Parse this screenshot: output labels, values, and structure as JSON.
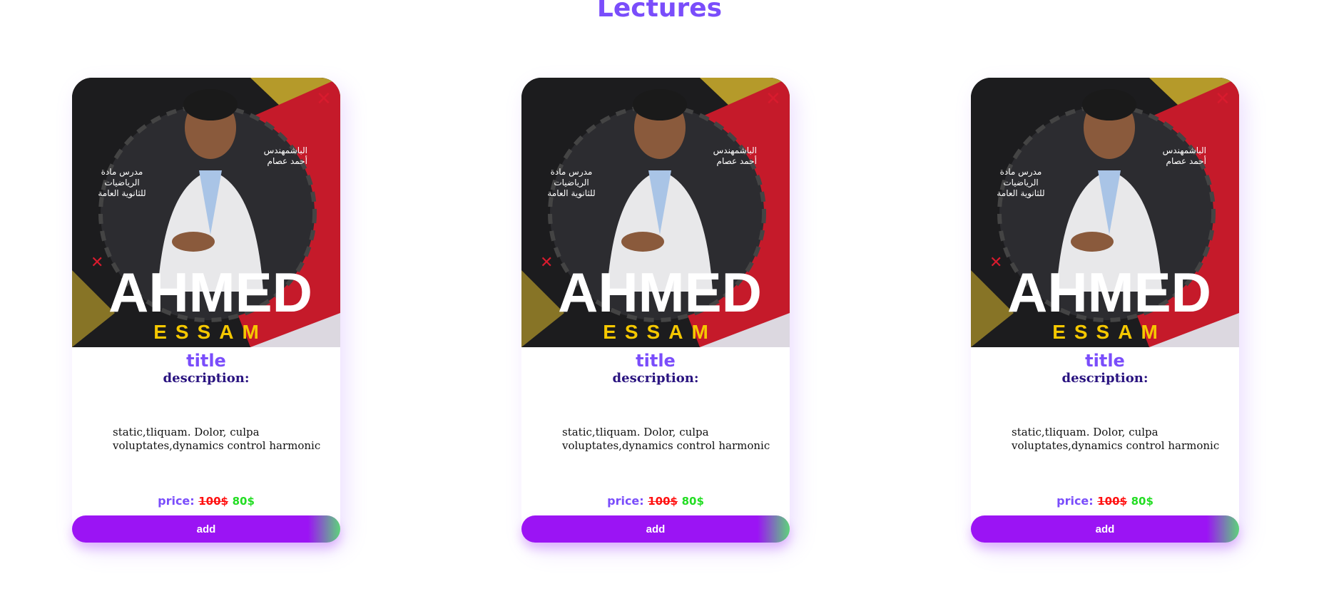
{
  "page": {
    "title": "Lectures"
  },
  "colors": {
    "accent": "#7a4dfb",
    "description_label": "#2a1480",
    "old_price": "#ff1010",
    "new_price": "#22dd22",
    "button": "#9b14f4"
  },
  "cards": [
    {
      "image": {
        "name_first": "AHMED",
        "name_last": "ESSAM",
        "arabic_name_line1": "الباشمهندس",
        "arabic_name_line2": "أحمد عصام",
        "arabic_subject_line1": "مدرس مادة",
        "arabic_subject_line2": "الرياضيات",
        "arabic_subject_line3": "للثانوية العامة"
      },
      "title": "title",
      "description_label": "description:",
      "description_text": "static,tliquam. Dolor, culpa voluptates,dynamics control harmonic",
      "price_label": "price:",
      "price_old": "100$",
      "price_new": "80$",
      "button_label": "add"
    },
    {
      "image": {
        "name_first": "AHMED",
        "name_last": "ESSAM",
        "arabic_name_line1": "الباشمهندس",
        "arabic_name_line2": "أحمد عصام",
        "arabic_subject_line1": "مدرس مادة",
        "arabic_subject_line2": "الرياضيات",
        "arabic_subject_line3": "للثانوية العامة"
      },
      "title": "title",
      "description_label": "description:",
      "description_text": "static,tliquam. Dolor, culpa voluptates,dynamics control harmonic",
      "price_label": "price:",
      "price_old": "100$",
      "price_new": "80$",
      "button_label": "add"
    },
    {
      "image": {
        "name_first": "AHMED",
        "name_last": "ESSAM",
        "arabic_name_line1": "الباشمهندس",
        "arabic_name_line2": "أحمد عصام",
        "arabic_subject_line1": "مدرس مادة",
        "arabic_subject_line2": "الرياضيات",
        "arabic_subject_line3": "للثانوية العامة"
      },
      "title": "title",
      "description_label": "description:",
      "description_text": "static,tliquam. Dolor, culpa voluptates,dynamics control harmonic",
      "price_label": "price:",
      "price_old": "100$",
      "price_new": "80$",
      "button_label": "add"
    }
  ]
}
